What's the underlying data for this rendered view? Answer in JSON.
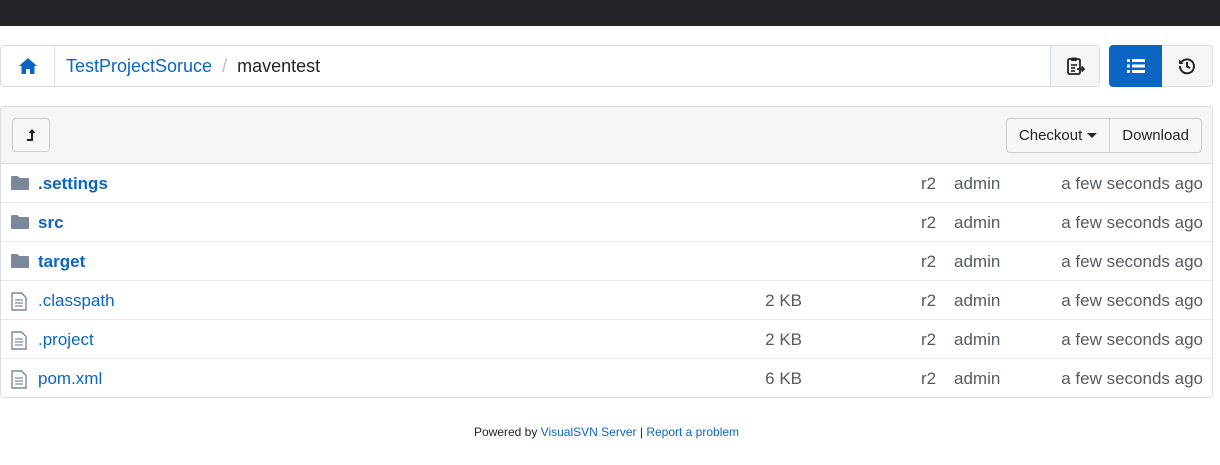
{
  "breadcrumb": {
    "project": "TestProjectSoruce",
    "separator": "/",
    "current": "maventest"
  },
  "toolbar": {
    "checkout_label": "Checkout",
    "download_label": "Download"
  },
  "files": [
    {
      "name": ".settings",
      "type": "dir",
      "size": "",
      "revision": "r2",
      "author": "admin",
      "modified": "a few seconds ago"
    },
    {
      "name": "src",
      "type": "dir",
      "size": "",
      "revision": "r2",
      "author": "admin",
      "modified": "a few seconds ago"
    },
    {
      "name": "target",
      "type": "dir",
      "size": "",
      "revision": "r2",
      "author": "admin",
      "modified": "a few seconds ago"
    },
    {
      "name": ".classpath",
      "type": "file",
      "size": "2 KB",
      "revision": "r2",
      "author": "admin",
      "modified": "a few seconds ago"
    },
    {
      "name": ".project",
      "type": "file",
      "size": "2 KB",
      "revision": "r2",
      "author": "admin",
      "modified": "a few seconds ago"
    },
    {
      "name": "pom.xml",
      "type": "file",
      "size": "6 KB",
      "revision": "r2",
      "author": "admin",
      "modified": "a few seconds ago"
    }
  ],
  "footer": {
    "powered_by": "Powered by",
    "product": "VisualSVN Server",
    "divider": "|",
    "report": "Report a problem"
  },
  "icons": {
    "home": "home-icon",
    "copy": "clipboard-copy-icon",
    "list_view": "list-view-icon",
    "history": "history-icon",
    "up": "level-up-icon",
    "folder": "folder-icon",
    "file": "file-icon"
  },
  "colors": {
    "accent": "#0b65c2",
    "topbar": "#212529",
    "folder": "#7a889c"
  }
}
